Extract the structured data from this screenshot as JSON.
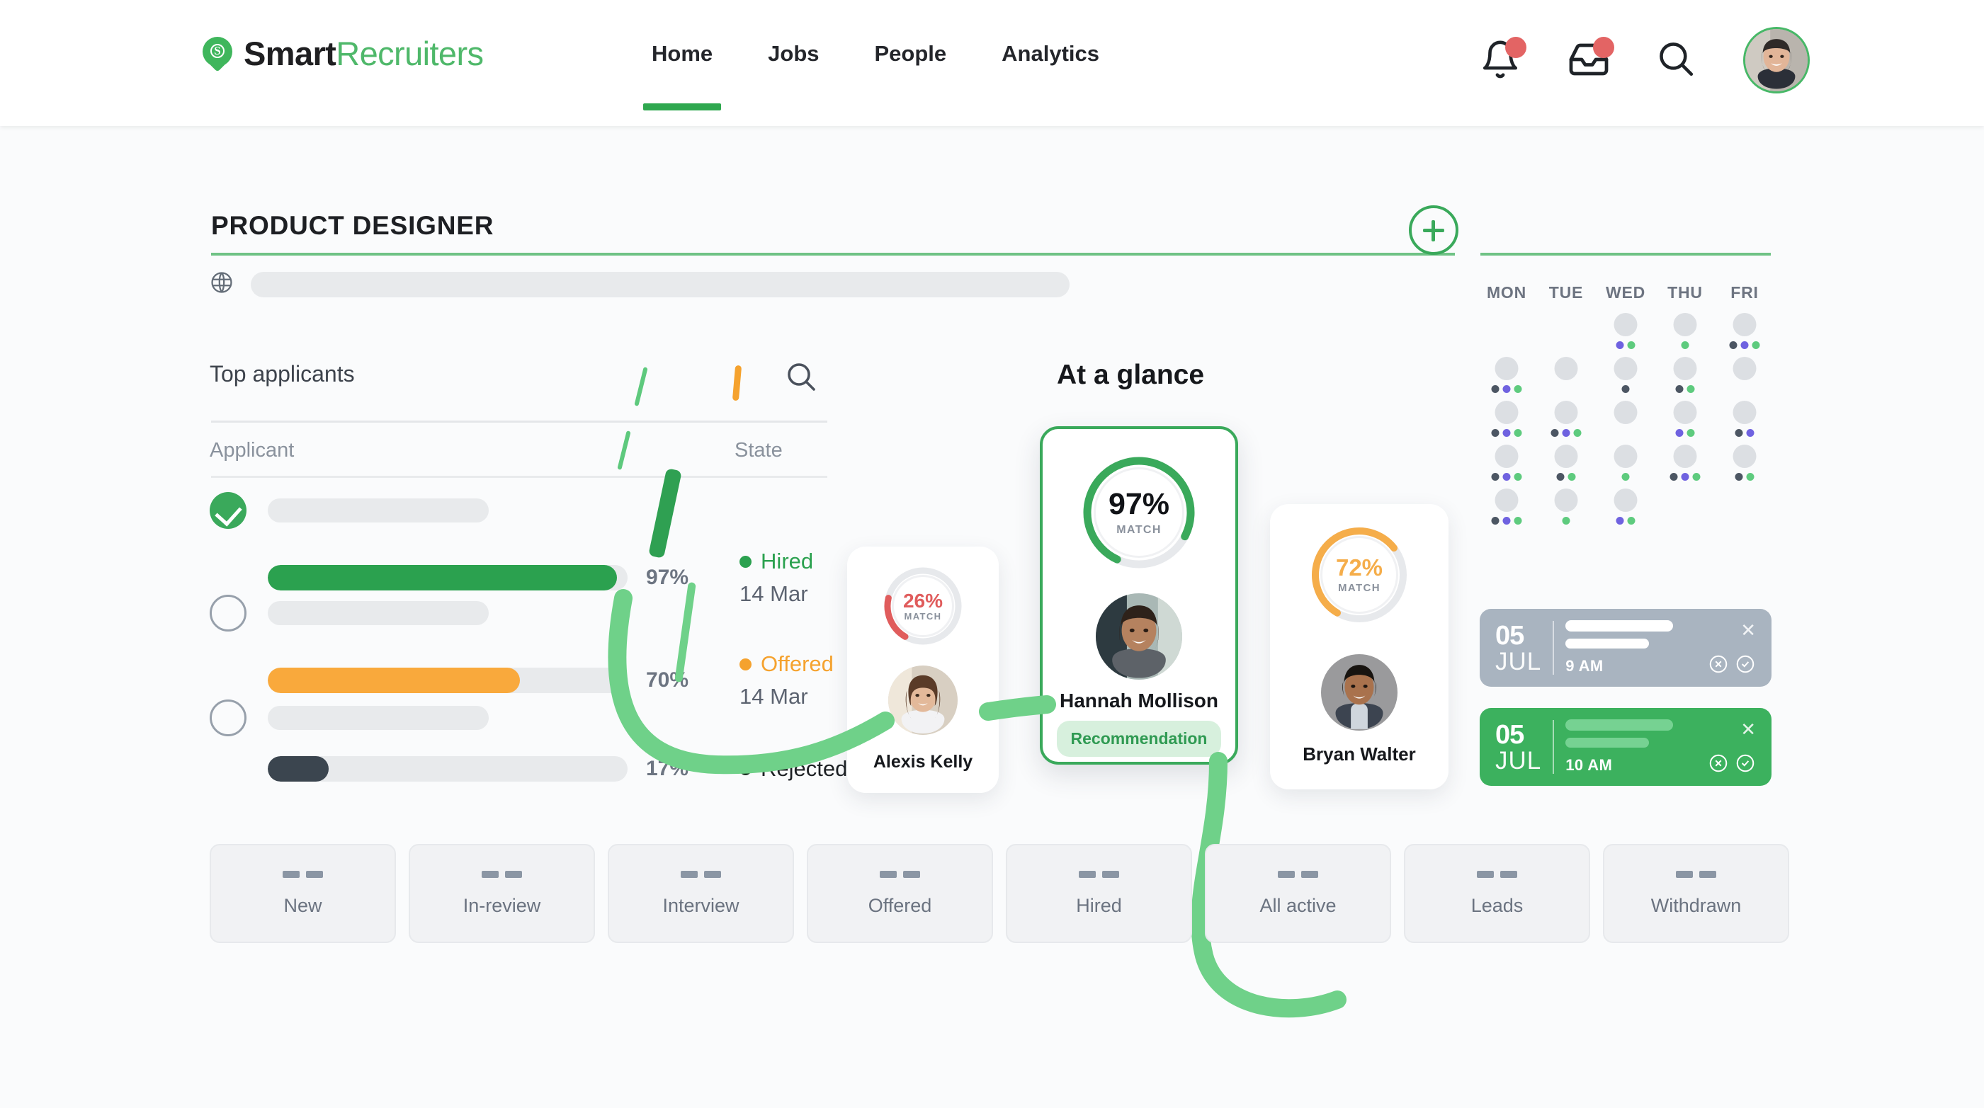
{
  "brand": {
    "part1": "Smart",
    "part2": "Recruiters",
    "logo_icon": "smartrecruiters-pin-icon",
    "logo_letter": "S"
  },
  "nav": {
    "items": [
      {
        "label": "Home",
        "active": true
      },
      {
        "label": "Jobs",
        "active": false
      },
      {
        "label": "People",
        "active": false
      },
      {
        "label": "Analytics",
        "active": false
      }
    ],
    "icons": [
      {
        "name": "notifications-bell-icon",
        "badge": true
      },
      {
        "name": "inbox-tray-icon",
        "badge": true
      },
      {
        "name": "search-icon",
        "badge": false
      }
    ],
    "avatar": "user-avatar"
  },
  "job": {
    "title": "PRODUCT DESIGNER",
    "add_button": "add-job-button",
    "globe_icon": "globe-icon"
  },
  "top_applicants": {
    "title": "Top applicants",
    "search_icon": "search-icon",
    "columns": {
      "applicant": "Applicant",
      "state": "State"
    },
    "rows": [
      {
        "selected": true,
        "percent": "97%",
        "fill": 97,
        "color": "#2ba14f",
        "state": "Hired",
        "state_color": "#2ba14f",
        "date": "14 Mar"
      },
      {
        "selected": false,
        "percent": "70%",
        "fill": 70,
        "color": "#f9a93c",
        "state": "Offered",
        "state_color": "#f5a22e",
        "date": "14 Mar"
      },
      {
        "selected": false,
        "percent": "17%",
        "fill": 17,
        "color": "#3b454f",
        "state": "Rejected",
        "state_color": "#1c3022",
        "date": ""
      }
    ]
  },
  "at_a_glance": {
    "title": "At a glance",
    "candidates": [
      {
        "name": "Alexis Kelly",
        "match": "26%",
        "match_label": "MATCH",
        "value": 26,
        "color": "#e05c5c",
        "featured": false,
        "badge": ""
      },
      {
        "name": "Hannah Mollison",
        "match": "97%",
        "match_label": "MATCH",
        "value": 97,
        "color": "#3aa95b",
        "featured": true,
        "badge": "Recommendation"
      },
      {
        "name": "Bryan Walter",
        "match": "72%",
        "match_label": "MATCH",
        "value": 72,
        "color": "#f5ad4a",
        "featured": false,
        "badge": ""
      }
    ]
  },
  "calendar": {
    "weekdays": [
      "MON",
      "TUE",
      "WED",
      "THU",
      "FRI"
    ],
    "dot_colors": {
      "grey": "#4c5663",
      "purple": "#6f62e0",
      "green": "#5ecb7e"
    },
    "grid": [
      [
        {
          "day": false,
          "dots": []
        },
        {
          "day": false,
          "dots": []
        },
        {
          "day": true,
          "dots": [
            "purple",
            "green"
          ]
        },
        {
          "day": true,
          "dots": [
            "green"
          ]
        },
        {
          "day": true,
          "dots": [
            "grey",
            "purple",
            "green"
          ]
        }
      ],
      [
        {
          "day": true,
          "dots": [
            "grey",
            "purple",
            "green"
          ]
        },
        {
          "day": true,
          "dots": []
        },
        {
          "day": true,
          "dots": [
            "grey"
          ]
        },
        {
          "day": true,
          "dots": [
            "grey",
            "green"
          ]
        },
        {
          "day": true,
          "dots": []
        }
      ],
      [
        {
          "day": true,
          "dots": [
            "grey",
            "purple",
            "green"
          ]
        },
        {
          "day": true,
          "dots": [
            "grey",
            "purple",
            "green"
          ]
        },
        {
          "day": true,
          "dots": []
        },
        {
          "day": true,
          "dots": [
            "purple",
            "green"
          ]
        },
        {
          "day": true,
          "dots": [
            "grey",
            "purple"
          ]
        }
      ],
      [
        {
          "day": true,
          "dots": [
            "grey",
            "purple",
            "green"
          ]
        },
        {
          "day": true,
          "dots": [
            "grey",
            "green"
          ]
        },
        {
          "day": true,
          "dots": [
            "green"
          ]
        },
        {
          "day": true,
          "dots": [
            "grey",
            "purple",
            "green"
          ]
        },
        {
          "day": true,
          "dots": [
            "grey",
            "green"
          ]
        }
      ],
      [
        {
          "day": true,
          "dots": [
            "grey",
            "purple",
            "green"
          ]
        },
        {
          "day": true,
          "dots": [
            "green"
          ]
        },
        {
          "day": true,
          "dots": [
            "purple",
            "green"
          ]
        },
        {
          "day": false,
          "dots": []
        },
        {
          "day": false,
          "dots": []
        }
      ]
    ],
    "events": [
      {
        "day": "05",
        "month": "JUL",
        "time": "9 AM",
        "bg": "#a9b4c0",
        "accent": "#ffffff",
        "close_icon": "close-icon",
        "decline_icon": "decline-circle-icon",
        "accept_icon": "accept-circle-icon"
      },
      {
        "day": "05",
        "month": "JUL",
        "time": "10 AM",
        "bg": "#3cb15e",
        "accent": "#76d292",
        "close_icon": "close-icon",
        "decline_icon": "decline-circle-icon",
        "accept_icon": "accept-circle-icon"
      }
    ]
  },
  "stages": {
    "tiles": [
      {
        "label": "New"
      },
      {
        "label": "In-review"
      },
      {
        "label": "Interview"
      },
      {
        "label": "Offered"
      },
      {
        "label": "Hired"
      },
      {
        "label": "All active"
      },
      {
        "label": "Leads"
      },
      {
        "label": "Withdrawn"
      }
    ]
  },
  "colors": {
    "brand_green": "#3aa95b",
    "light_green": "#6fd189",
    "accent_orange": "#f5a22e",
    "accent_red": "#e05c5c",
    "page_bg": "#fafbfc"
  }
}
